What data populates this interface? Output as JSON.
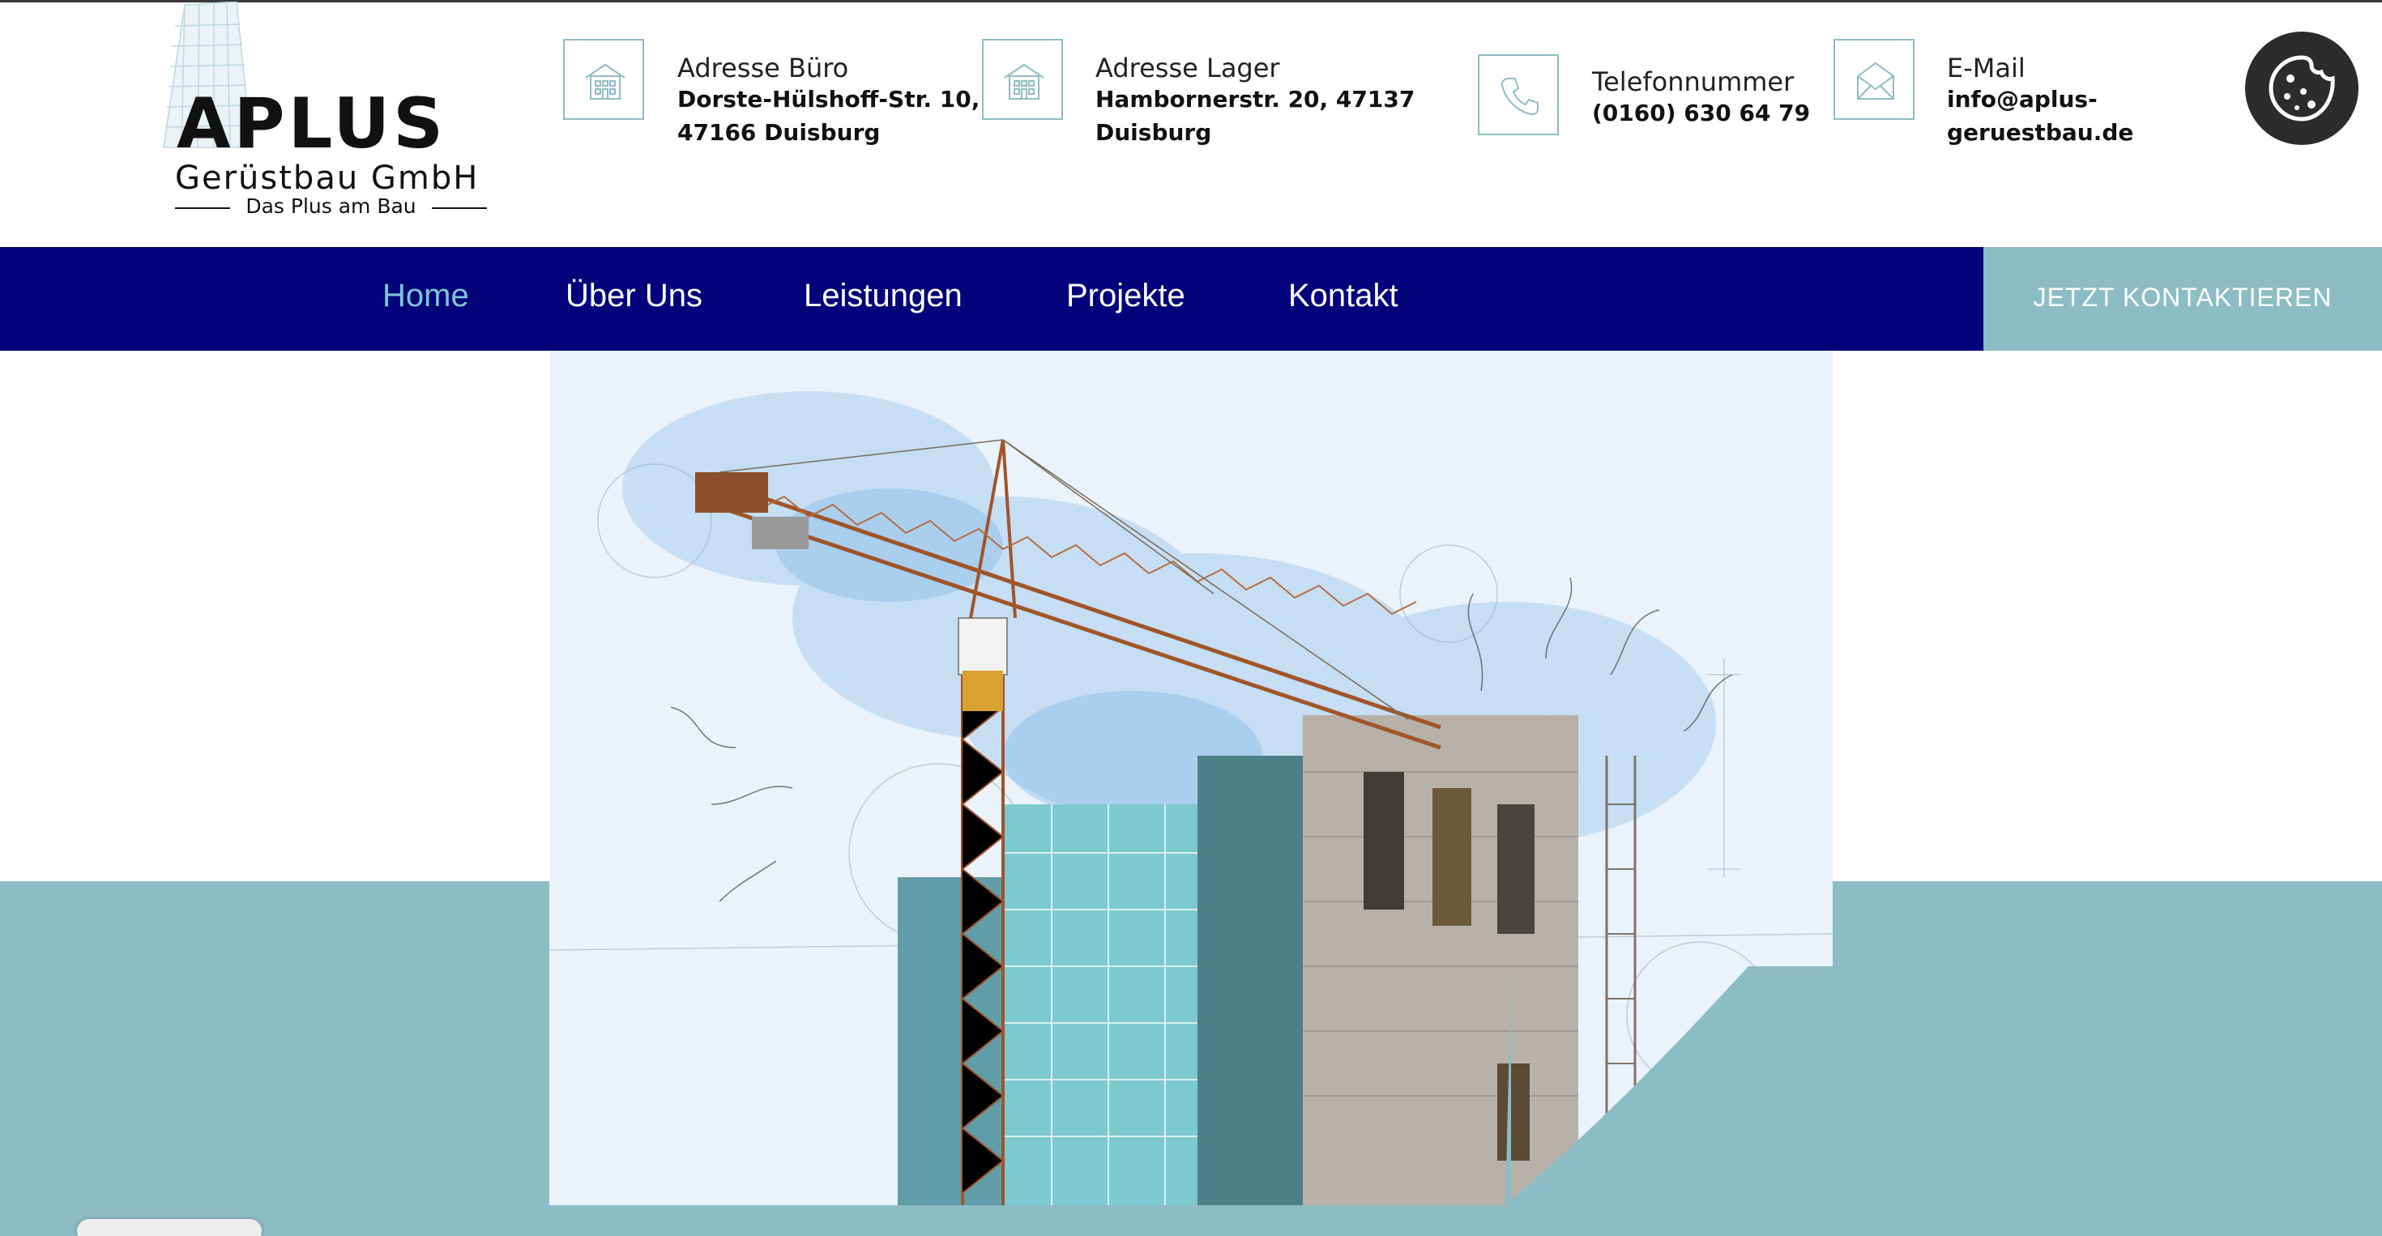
{
  "header": {
    "logo": {
      "brand": "APLUS",
      "company": "Gerüstbau GmbH",
      "tagline": "Das Plus am Bau"
    },
    "contacts": [
      {
        "icon": "building-icon",
        "label": "Adresse Büro",
        "line1": "Dorste-Hülshoff-Str. 10,",
        "line2": "47166 Duisburg"
      },
      {
        "icon": "building-icon",
        "label": "Adresse Lager",
        "line1": "Hambornerstr. 20, 47137",
        "line2": "Duisburg"
      },
      {
        "icon": "phone-icon",
        "label": "Telefonnummer",
        "line1": "(0160) 630 64 79"
      },
      {
        "icon": "envelope-icon",
        "label": "E-Mail",
        "line1": "info@aplus-",
        "line2": "geruestbau.de"
      }
    ],
    "cookie_icon": "cookie-icon"
  },
  "nav": {
    "items": [
      {
        "label": "Home",
        "active": true
      },
      {
        "label": "Über Uns"
      },
      {
        "label": "Leistungen"
      },
      {
        "label": "Projekte"
      },
      {
        "label": "Kontakt"
      }
    ],
    "cta": "JETZT KONTAKTIEREN"
  },
  "colors": {
    "nav_bg": "#02027a",
    "accent": "#8dbdc4",
    "active_link": "#7fc5d0"
  }
}
